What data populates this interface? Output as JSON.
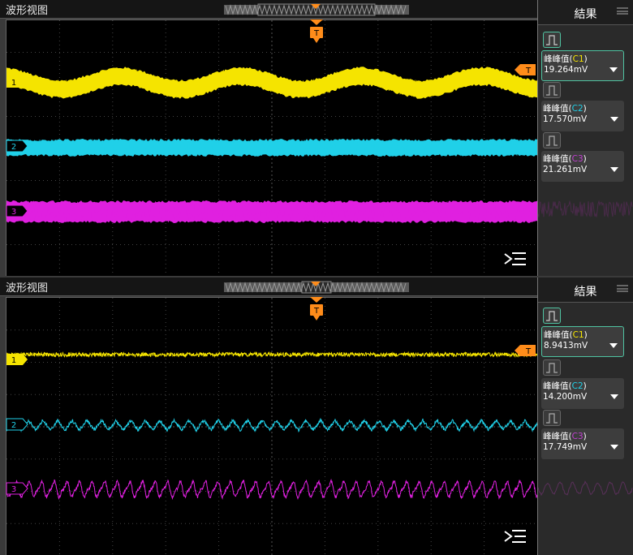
{
  "panels": [
    {
      "view_title": "波形视图",
      "results_title": "結果",
      "trigger_label": "T",
      "trigger_level_label": "T",
      "channels": [
        {
          "marker": "1",
          "color": "#f5e400",
          "level": 0.22
        },
        {
          "marker": "2",
          "color": "#20d0e8",
          "level": 0.5
        },
        {
          "marker": "3",
          "color": "#e020e0",
          "level": 0.76
        }
      ],
      "results": [
        {
          "name_prefix": "峰峰值(",
          "channel": "C1",
          "name_suffix": ")",
          "value": "19.264mV",
          "selected": true
        },
        {
          "name_prefix": "峰峰值(",
          "channel": "C2",
          "name_suffix": ")",
          "value": "17.570mV",
          "selected": false
        },
        {
          "name_prefix": "峰峰值(",
          "channel": "C3",
          "name_suffix": ")",
          "value": "21.261mV",
          "selected": false
        }
      ]
    },
    {
      "view_title": "波形视图",
      "results_title": "結果",
      "trigger_label": "T",
      "trigger_level_label": "T",
      "channels": [
        {
          "marker": "1",
          "color": "#f5e400",
          "level": 0.22
        },
        {
          "marker": "2",
          "color": "#20d0e8",
          "level": 0.5
        },
        {
          "marker": "3",
          "color": "#e020e0",
          "level": 0.76
        }
      ],
      "results": [
        {
          "name_prefix": "峰峰值(",
          "channel": "C1",
          "name_suffix": ")",
          "value": "8.9413mV",
          "selected": true
        },
        {
          "name_prefix": "峰峰值(",
          "channel": "C2",
          "name_suffix": ")",
          "value": "14.200mV",
          "selected": false
        },
        {
          "name_prefix": "峰峰值(",
          "channel": "C3",
          "name_suffix": ")",
          "value": "17.749mV",
          "selected": false
        }
      ]
    }
  ]
}
